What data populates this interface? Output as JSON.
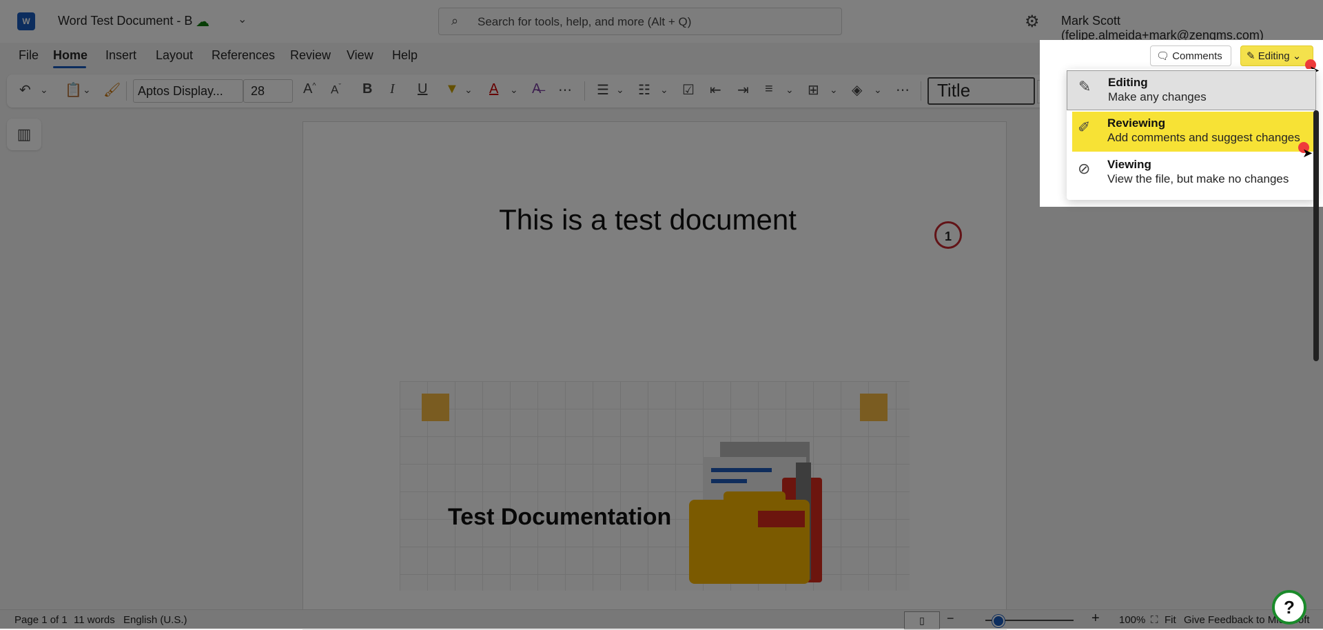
{
  "titlebar": {
    "app_icon": "W",
    "document_title": "Word Test Document - B",
    "search_placeholder": "Search for tools, help, and more (Alt + Q)",
    "user": "Mark Scott (felipe.almeida+mark@zenqms.com)"
  },
  "tabs": [
    "File",
    "Home",
    "Insert",
    "Layout",
    "References",
    "Review",
    "View",
    "Help"
  ],
  "ribbon": {
    "font_name": "Aptos Display...",
    "font_size": "28",
    "style": "Title"
  },
  "document": {
    "heading": "This is a test document",
    "comment_count": "1",
    "graphic_label": "Test Documentation"
  },
  "mode_panel": {
    "comments_label": "Comments",
    "mode_label": "Editing",
    "options": [
      {
        "title": "Editing",
        "desc": "Make any changes",
        "icon": "pencil-icon"
      },
      {
        "title": "Reviewing",
        "desc": "Add comments and suggest changes",
        "icon": "reviewing-icon"
      },
      {
        "title": "Viewing",
        "desc": "View the file, but make no changes",
        "icon": "eye-off-icon"
      }
    ]
  },
  "statusbar": {
    "page": "Page 1 of 1",
    "words": "11 words",
    "language": "English (U.S.)",
    "zoom": "100%",
    "fit": "Fit",
    "feedback": "Give Feedback to Microsoft"
  },
  "colors": {
    "accent": "#185abd",
    "highlight": "#f7e235",
    "comment_ring": "#c4262e"
  }
}
